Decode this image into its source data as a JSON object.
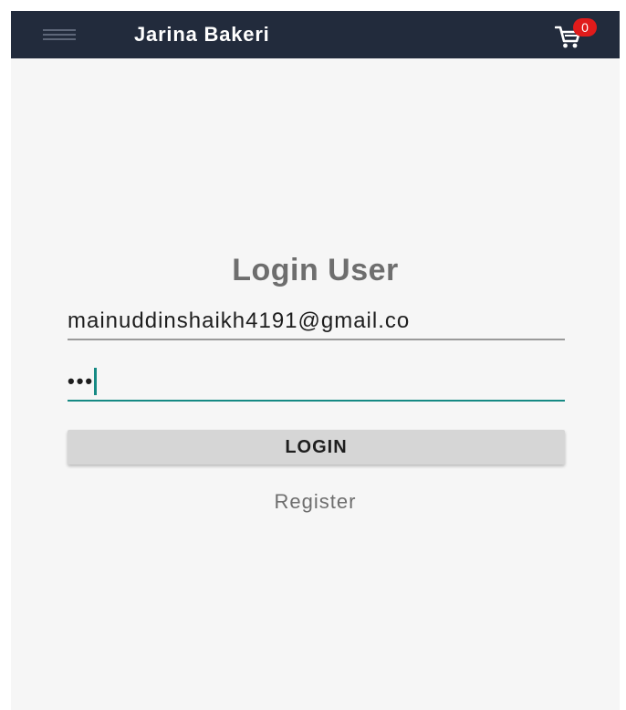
{
  "app_bar": {
    "title": "Jarina Bakeri",
    "menu_icon": "hamburger-menu-icon",
    "cart_icon": "shopping-cart-icon",
    "cart_count": "0",
    "background_color": "#222b3c",
    "badge_color": "#e01b1b"
  },
  "login_form": {
    "heading": "Login User",
    "email_value": "mainuddinshaikh4191@gmail.co",
    "password_mask": "•••",
    "login_button_label": "LOGIN",
    "register_link_label": "Register",
    "accent_color": "#168a84"
  }
}
